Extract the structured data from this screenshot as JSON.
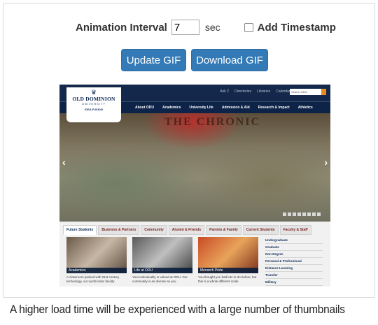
{
  "controls": {
    "interval_label": "Animation Interval",
    "interval_value": "7",
    "interval_unit": "sec",
    "timestamp_label": "Add Timestamp",
    "timestamp_checked": false
  },
  "buttons": {
    "update": "Update GIF",
    "download": "Download GIF"
  },
  "preview": {
    "top_links": [
      "Ask Z",
      "Directories",
      "Libraries",
      "Calendars"
    ],
    "search_placeholder": "Search ODU",
    "logo": {
      "name": "OLD DOMINION",
      "sub": "UNIVERSITY",
      "tagline": "IDEA FUSION"
    },
    "nav_items": [
      "About ODU",
      "Academics",
      "University Life",
      "Admission & Aid",
      "Research & Impact",
      "Athletics"
    ],
    "hero_sign": "THE CHRONIC",
    "tabs": [
      "Future Students",
      "Business & Partners",
      "Community",
      "Alumni & Friends",
      "Parents & Family",
      "Current Students",
      "Faculty & Staff"
    ],
    "tiles": [
      {
        "caption": "Academics",
        "text": "A classroom packed with 21st century technology, our world-class faculty"
      },
      {
        "caption": "Life at ODU",
        "text": "Your individuality is valued at ODU. Our community is as diverse as you"
      },
      {
        "caption": "Monarch Pride",
        "text": "You thought you had lots to do before, but this is a whole different scale"
      }
    ],
    "quick_links": [
      "Undergraduate",
      "Graduate",
      "Non-Degree",
      "Personal & Professional",
      "Distance Learning",
      "Transfer",
      "Military"
    ]
  },
  "notice": "A higher load time will be experienced with a large number of thumbnails"
}
